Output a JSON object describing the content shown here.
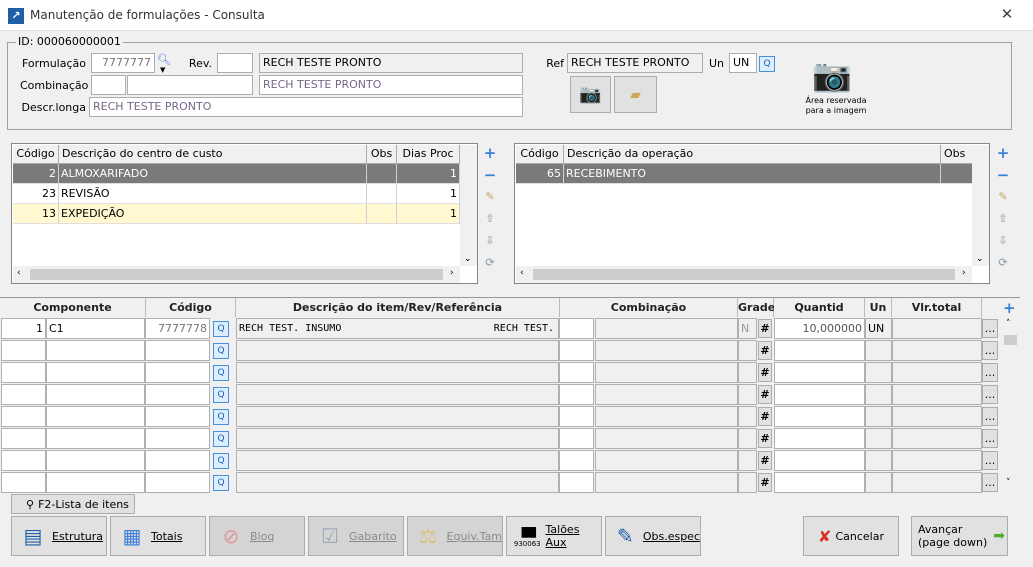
{
  "window": {
    "title": "Manutenção de formulações - Consulta",
    "close": "✕"
  },
  "header": {
    "id_label": "ID: 000060000001",
    "formulacao_label": "Formulação",
    "formulacao_value": "7777777",
    "rev_label": "Rev.",
    "rev_value": "",
    "formulacao_desc": "RECH TESTE PRONTO",
    "combinacao_label": "Combinação",
    "combinacao_code": "",
    "combinacao_code2": "",
    "combinacao_desc": "RECH TESTE PRONTO",
    "descr_longa_label": "Descr.longa",
    "descr_longa_value": "RECH TESTE PRONTO",
    "ref_label": "Ref",
    "ref_value": "RECH TESTE PRONTO",
    "un_label": "Un",
    "un_value": "UN",
    "image_area_text_1": "Área reservada",
    "image_area_text_2": "para a imagem"
  },
  "cost_centers": {
    "columns": [
      "Código",
      "Descrição do centro de custo",
      "Obs",
      "Dias Proc"
    ],
    "rows": [
      {
        "codigo": "2",
        "descricao": "ALMOXARIFADO",
        "obs": "",
        "dias": "1",
        "state": "selected"
      },
      {
        "codigo": "23",
        "descricao": "REVISÃO",
        "obs": "",
        "dias": "1",
        "state": "normal"
      },
      {
        "codigo": "13",
        "descricao": "EXPEDIÇÃO",
        "obs": "",
        "dias": "1",
        "state": "highlight"
      }
    ]
  },
  "operations": {
    "columns": [
      "Código",
      "Descrição da operação",
      "Obs"
    ],
    "rows": [
      {
        "codigo": "65",
        "descricao": "RECEBIMENTO",
        "obs": "",
        "state": "selected"
      }
    ]
  },
  "items": {
    "columns": [
      "Componente",
      "Código",
      "Descrição do item/Rev/Referência",
      "Combinação",
      "Grade",
      "Quantid",
      "Un",
      "Vlr.total"
    ],
    "rows": [
      {
        "seq": "1",
        "componente": "C1",
        "codigo": "7777778",
        "descricao": "RECH TEST. INSUMO",
        "referencia": "RECH TEST.",
        "comb1": "",
        "comb2": "",
        "grade": "N",
        "grade_btn": "#",
        "quantid": "10,000000",
        "un": "UN",
        "vlr_total": "",
        "more": "..."
      },
      {
        "seq": "",
        "componente": "",
        "codigo": "",
        "descricao": "",
        "referencia": "",
        "comb1": "",
        "comb2": "",
        "grade": "",
        "grade_btn": "#",
        "quantid": "",
        "un": "",
        "vlr_total": "",
        "more": "..."
      },
      {
        "seq": "",
        "componente": "",
        "codigo": "",
        "descricao": "",
        "referencia": "",
        "comb1": "",
        "comb2": "",
        "grade": "",
        "grade_btn": "#",
        "quantid": "",
        "un": "",
        "vlr_total": "",
        "more": "..."
      },
      {
        "seq": "",
        "componente": "",
        "codigo": "",
        "descricao": "",
        "referencia": "",
        "comb1": "",
        "comb2": "",
        "grade": "",
        "grade_btn": "#",
        "quantid": "",
        "un": "",
        "vlr_total": "",
        "more": "..."
      },
      {
        "seq": "",
        "componente": "",
        "codigo": "",
        "descricao": "",
        "referencia": "",
        "comb1": "",
        "comb2": "",
        "grade": "",
        "grade_btn": "#",
        "quantid": "",
        "un": "",
        "vlr_total": "",
        "more": "..."
      },
      {
        "seq": "",
        "componente": "",
        "codigo": "",
        "descricao": "",
        "referencia": "",
        "comb1": "",
        "comb2": "",
        "grade": "",
        "grade_btn": "#",
        "quantid": "",
        "un": "",
        "vlr_total": "",
        "more": "..."
      },
      {
        "seq": "",
        "componente": "",
        "codigo": "",
        "descricao": "",
        "referencia": "",
        "comb1": "",
        "comb2": "",
        "grade": "",
        "grade_btn": "#",
        "quantid": "",
        "un": "",
        "vlr_total": "",
        "more": "..."
      },
      {
        "seq": "",
        "componente": "",
        "codigo": "",
        "descricao": "",
        "referencia": "",
        "comb1": "",
        "comb2": "",
        "grade": "",
        "grade_btn": "#",
        "quantid": "",
        "un": "",
        "vlr_total": "",
        "more": "..."
      }
    ]
  },
  "toolbar": {
    "f2_label": "F2-Lista de itens",
    "buttons": [
      {
        "label": "Estrutura",
        "icon": "structure-icon",
        "enabled": true
      },
      {
        "label": "Totais",
        "icon": "table-icon",
        "enabled": true
      },
      {
        "label": "Bloq",
        "icon": "block-icon",
        "enabled": false
      },
      {
        "label": "Gabarito",
        "icon": "checklist-icon",
        "enabled": false
      },
      {
        "label": "Equiv.Tam",
        "icon": "scale-icon",
        "enabled": false
      },
      {
        "label": "Talões Aux",
        "icon": "barcode-icon",
        "enabled": true,
        "barcode_text": "930063"
      },
      {
        "label": "Obs.espec",
        "icon": "notepad-icon",
        "enabled": true
      }
    ],
    "cancel_label": "Cancelar",
    "next_label_1": "Avançar",
    "next_label_2": "(page down)"
  },
  "colors": {
    "selected_row": "#7a7a7a",
    "highlight_row": "#fff8d0",
    "add_icon": "#3c7fd6"
  }
}
